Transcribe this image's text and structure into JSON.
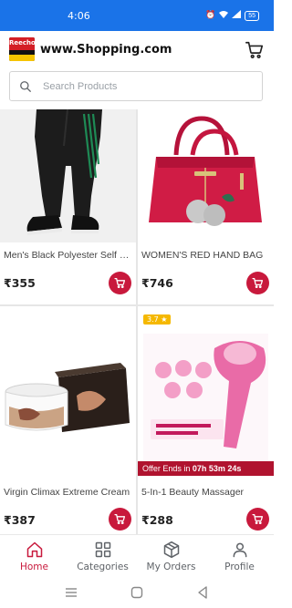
{
  "status_bar": {
    "time": "4:06",
    "icons": [
      "alarm-icon",
      "wifi-icon",
      "signal-icon"
    ],
    "battery": "55"
  },
  "header": {
    "logo_text": "Reecho",
    "title": "www.Shopping.com"
  },
  "search": {
    "placeholder": "Search Products",
    "value": ""
  },
  "products": [
    {
      "name": "Men's Black Polyester Self P...",
      "price": "₹355"
    },
    {
      "name": "WOMEN'S RED HAND BAG",
      "price": "₹746"
    },
    {
      "name": "Virgin Climax Extreme Cream",
      "price": "₹387"
    },
    {
      "name": "5-In-1 Beauty Massager",
      "price": "₹288",
      "rating": "3.7 ★",
      "offer_prefix": "Offer Ends in",
      "offer_time": "07h 53m 24s"
    }
  ],
  "nav": {
    "home": "Home",
    "categories": "Categories",
    "orders": "My Orders",
    "profile": "Profile"
  },
  "colors": {
    "status_bar": "#1a73e8",
    "accent": "#c8193c",
    "offer_banner": "#b0132f",
    "rating": "#f5b800"
  }
}
